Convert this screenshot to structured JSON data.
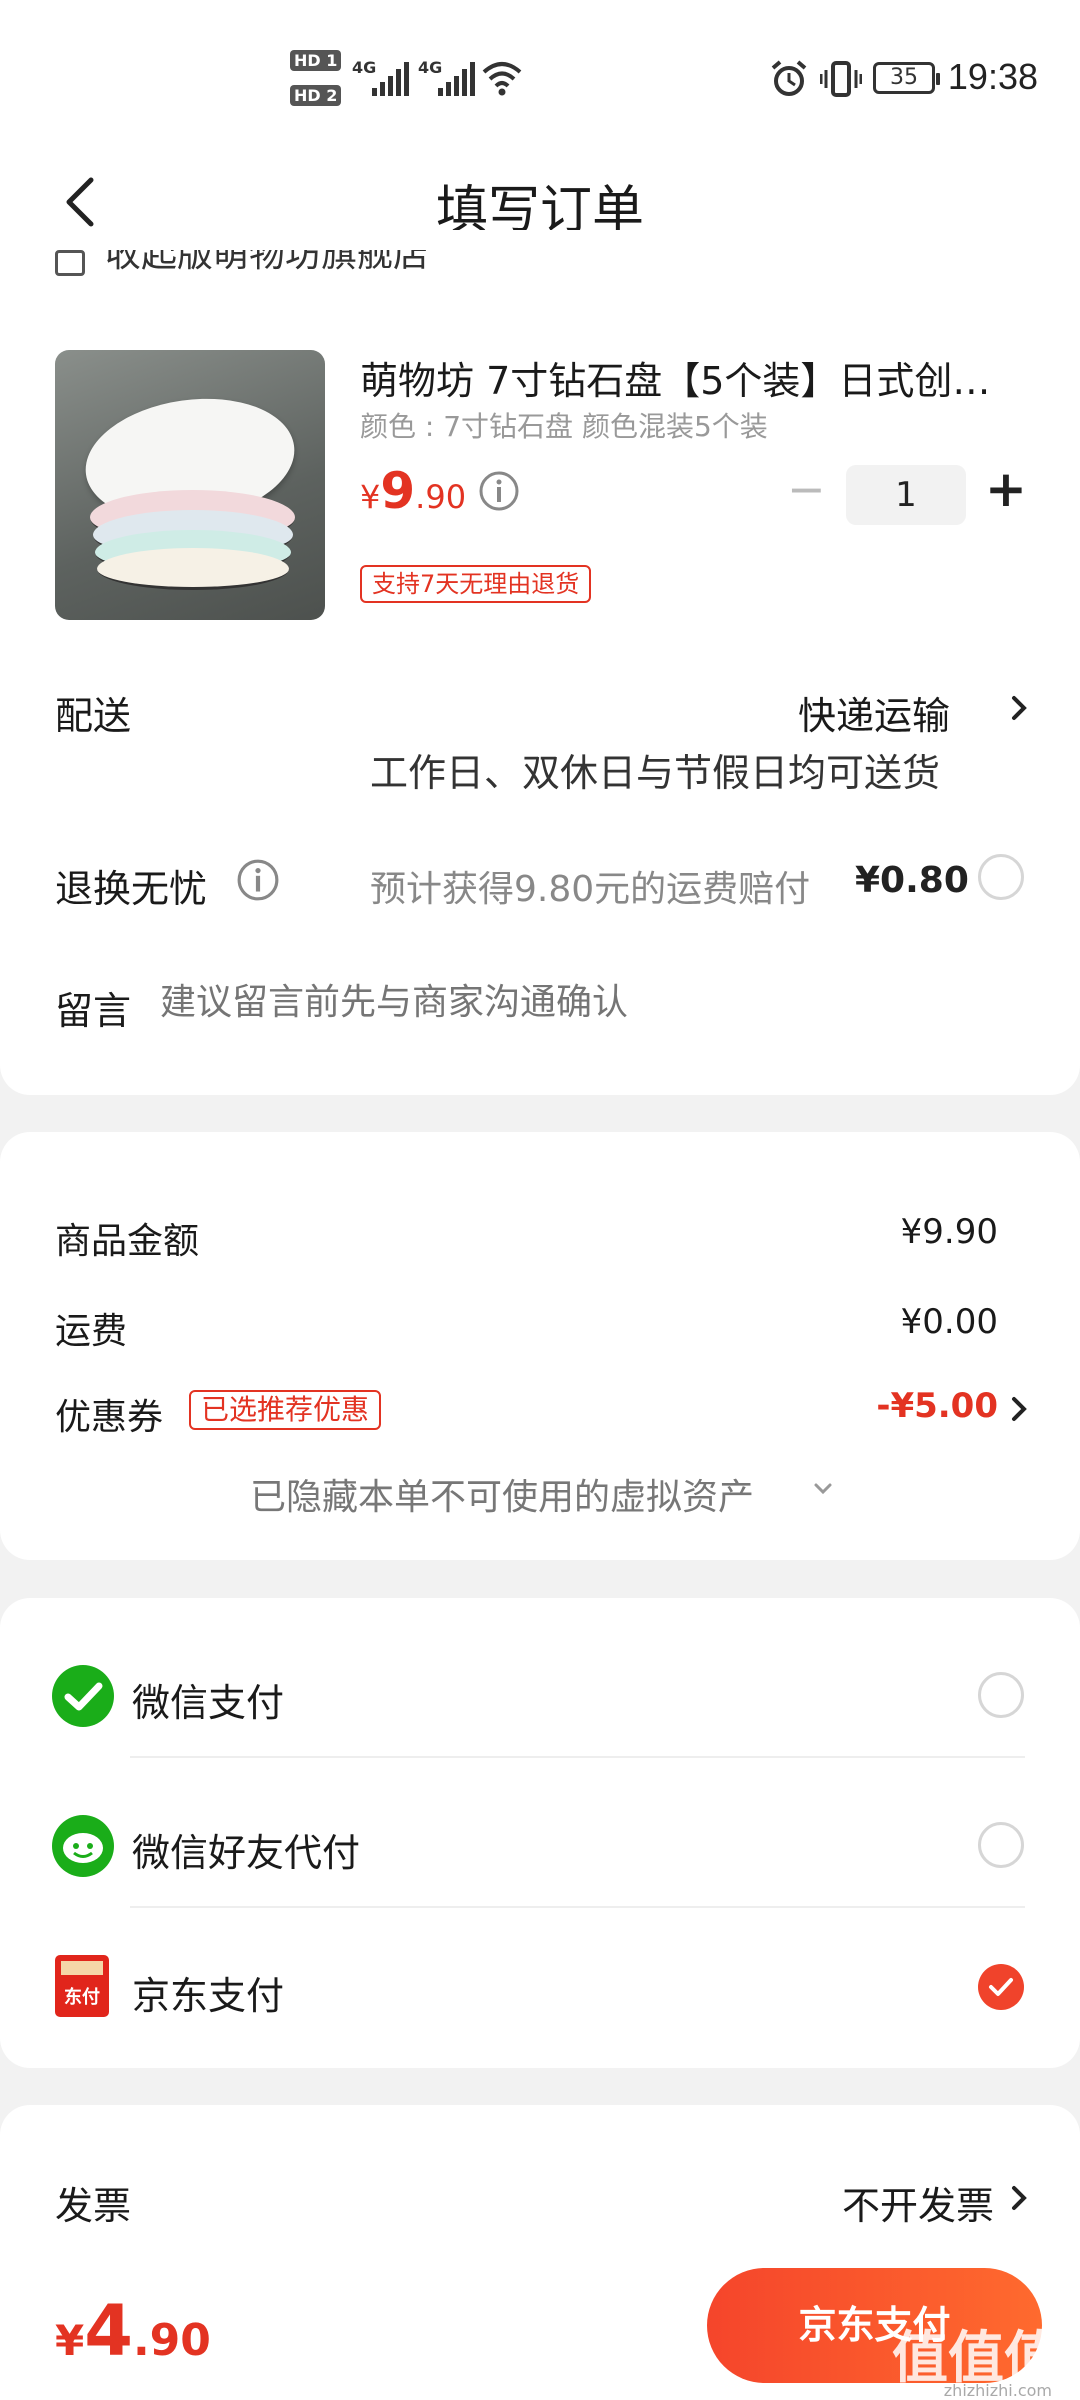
{
  "status_bar": {
    "hd1": "HD 1",
    "hd2": "HD 2",
    "net1": "4G",
    "net2": "4G",
    "battery": "35",
    "time": "19:38"
  },
  "header": {
    "title": "填写订单"
  },
  "store": {
    "name": "收起版萌物坊旗舰店"
  },
  "product": {
    "title": "萌物坊  7寸钻石盘【5个装】日式创…",
    "spec": "颜色 : 7寸钻石盘 颜色混装5个装",
    "price_symbol": "¥",
    "price_int": "9",
    "price_dec": ".90",
    "quantity": "1",
    "minus": "−",
    "plus": "+",
    "return_tag": "支持7天无理由退货"
  },
  "delivery": {
    "label": "配送",
    "method": "快递运输",
    "note": "工作日、双休日与节假日均可送货"
  },
  "return_insurance": {
    "label": "退换无忧",
    "desc": "预计获得9.80元的运费赔付",
    "price": "¥0.80"
  },
  "message": {
    "label": "留言",
    "placeholder": "建议留言前先与商家沟通确认"
  },
  "summary": {
    "goods_label": "商品金额",
    "goods_value": "¥9.90",
    "shipping_label": "运费",
    "shipping_value": "¥0.00",
    "coupon_label": "优惠券",
    "coupon_tag": "已选推荐优惠",
    "coupon_value": "-¥5.00",
    "hidden_assets": "已隐藏本单不可使用的虚拟资产"
  },
  "payment": {
    "methods": [
      {
        "label": "微信支付",
        "icon": "wechat-pay-icon",
        "selected": false
      },
      {
        "label": "微信好友代付",
        "icon": "wechat-friend-pay-icon",
        "selected": false
      },
      {
        "label": "京东支付",
        "icon": "jd-pay-icon",
        "selected": true
      }
    ],
    "jd_icon_text": "东付"
  },
  "invoice": {
    "label": "发票",
    "value": "不开发票"
  },
  "footer": {
    "total_symbol": "¥",
    "total_int": "4",
    "total_dec": ".90",
    "pay_button": "京东支付",
    "watermark": "值值值",
    "watermark_site": "zhizhizhi.com"
  },
  "colors": {
    "accent": "#e33322",
    "pay_button": "#f5452b",
    "wechat": "#1aad19"
  }
}
